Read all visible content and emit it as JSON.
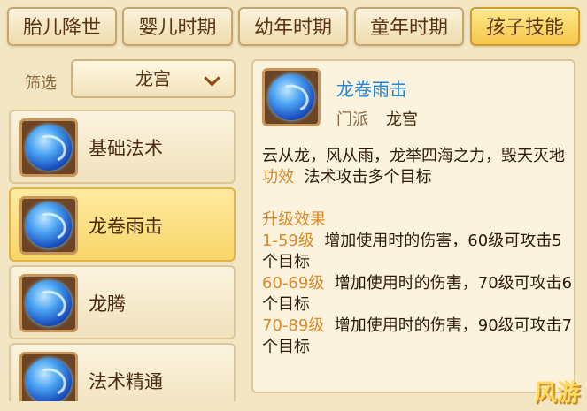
{
  "tabs": [
    "胎儿降世",
    "婴儿时期",
    "幼年时期",
    "童年时期",
    "孩子技能"
  ],
  "active_tab": 4,
  "filter": {
    "label": "筛选",
    "value": "龙宫"
  },
  "skills": [
    {
      "name": "基础法术"
    },
    {
      "name": "龙卷雨击"
    },
    {
      "name": "龙腾"
    },
    {
      "name": "法术精通"
    }
  ],
  "selected_skill": 1,
  "detail": {
    "title": "龙卷雨击",
    "school_label": "门派",
    "school": "龙宫",
    "description": "云从龙，风从雨，龙举四海之力，毁天灭地",
    "effect_label": "功效",
    "effect": "法术攻击多个目标",
    "upgrade_label": "升级效果",
    "upgrades": [
      {
        "range": "1-59级",
        "text": "增加使用时的伤害，60级可攻击5个目标"
      },
      {
        "range": "60-69级",
        "text": "增加使用时的伤害，70级可攻击6个目标"
      },
      {
        "range": "70-89级",
        "text": "增加使用时的伤害，90级可攻击7个目标"
      }
    ]
  },
  "watermark": "风游"
}
